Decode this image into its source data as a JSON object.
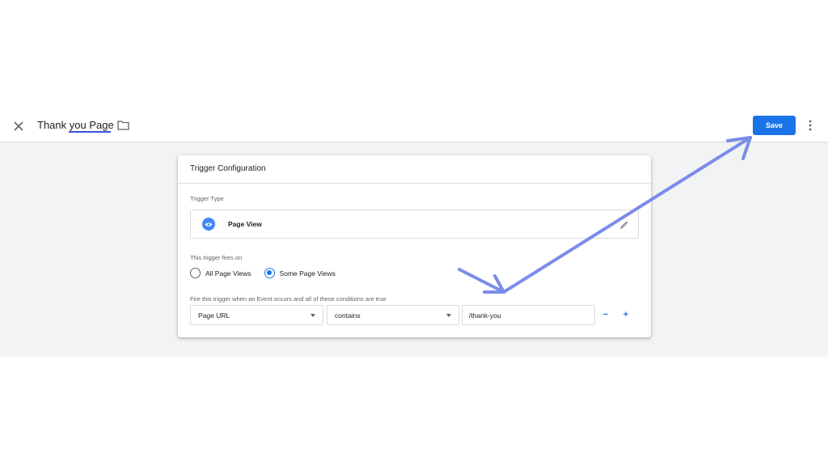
{
  "header": {
    "title": "Thank you Page",
    "save_label": "Save"
  },
  "card": {
    "title": "Trigger Configuration",
    "trigger_type_label": "Trigger Type",
    "trigger_type": {
      "name": "Page View",
      "icon": "eye-icon",
      "icon_color": "#4285f4"
    },
    "fires_on_label": "This trigger fires on",
    "fires_on_options": [
      {
        "label": "All Page Views",
        "selected": false
      },
      {
        "label": "Some Page Views",
        "selected": true
      }
    ],
    "condition_label": "Fire this trigger when an Event occurs and all of these conditions are true",
    "condition": {
      "variable": "Page URL",
      "operator": "contains",
      "value": "/thank-you"
    },
    "remove_label": "−",
    "add_label": "+"
  },
  "colors": {
    "accent": "#1a73e8",
    "annotation_arrow": "#7b8ce8"
  }
}
